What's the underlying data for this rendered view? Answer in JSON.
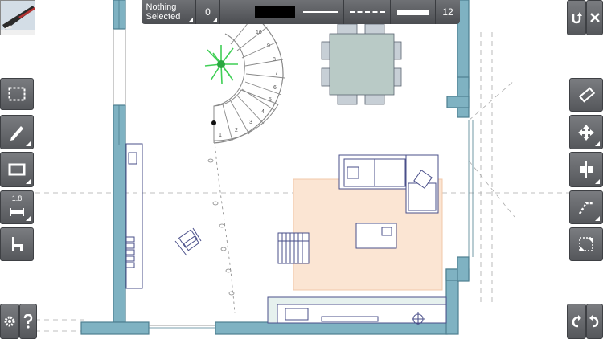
{
  "toolbar": {
    "selection_line1": "Nothing",
    "selection_line2": "Selected",
    "angle_value": "0",
    "line_width_value": "12",
    "fill_color": "#000000"
  },
  "left_tools": {
    "dimension_value": "1.8"
  },
  "colors": {
    "wall": "#7fb2c2",
    "wall_stroke": "#4e7f90",
    "rug": "#fbe5d3",
    "table": "#b9cac6",
    "furniture_stroke": "#4a4f8a",
    "plant": "#3fcf55",
    "toolbar": "#5e6064"
  },
  "icons": {
    "app_thumbnail": "pen-drawing-thumbnail",
    "select": "marquee-icon",
    "pencil": "pencil-icon",
    "rectangle": "rectangle-icon",
    "dimension": "dimension-icon",
    "furniture": "chair-icon",
    "settings": "gear-icon",
    "help": "question-icon",
    "undo": "undo-icon",
    "close": "close-icon",
    "eraser": "eraser-icon",
    "move": "move-icon",
    "align": "align-icon",
    "snap": "snap-icon",
    "resize": "resize-icon",
    "rotate_left": "rotate-left-icon",
    "rotate_right": "rotate-right-icon"
  },
  "stairs": {
    "step_numbers": [
      "1",
      "2",
      "3",
      "4",
      "5",
      "6",
      "7",
      "8",
      "9",
      "10"
    ]
  }
}
